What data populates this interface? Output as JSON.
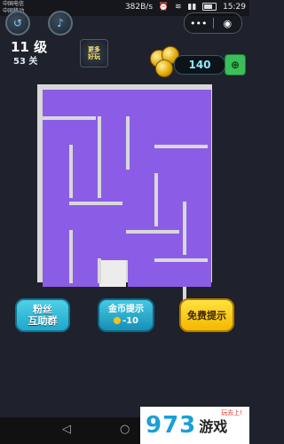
{
  "status": {
    "carrier1": "中国电信",
    "carrier2": "中国移动",
    "speed": "382B/s",
    "time": "15:29"
  },
  "header": {
    "level": "11 级",
    "stage": "53 关",
    "more_line1": "更多",
    "more_line2": "好玩",
    "coins": "140"
  },
  "buttons": {
    "fans_line1": "粉丝",
    "fans_line2": "互助群",
    "coin_hint": "金币提示",
    "coin_cost": "-10",
    "free_hint": "免费提示"
  },
  "miniprogram": {
    "menu": "•••",
    "close": "◉"
  },
  "board": {
    "rows": 7,
    "cols": 6,
    "filled_color": "#8b5de6",
    "empty_color": "#ececec",
    "empty_cells": [
      [
        6,
        2
      ]
    ]
  },
  "watermark": {
    "numbers": "973",
    "text": "游戏",
    "slogan": "玩去上!"
  },
  "colors": {
    "background": "#1f222c",
    "path": "#8b5de6",
    "hint_button": "#2bb4d6",
    "free_button": "#f7c600"
  }
}
